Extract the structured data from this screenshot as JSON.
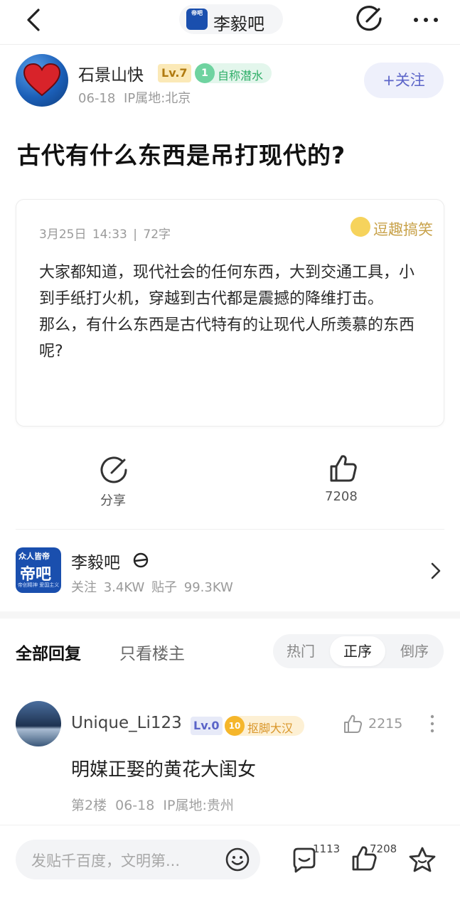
{
  "header": {
    "forum_name": "李毅吧",
    "forum_logo_text": "帝吧"
  },
  "author": {
    "name": "石景山快",
    "level": "Lv.7",
    "title_badge_num": "1",
    "title_badge": "自称潜水",
    "date": "06-18",
    "ip_location": "IP属地:北京",
    "follow_label": "+关注"
  },
  "post": {
    "title": "古代有什么东西是吊打现代的?",
    "card_meta": "3月25日 14:33 | 72字",
    "card_tag": "逗趣搞笑",
    "card_text": "大家都知道，现代社会的任何东西，大到交通工具，小到手纸打火机，穿越到古代都是震撼的降维打击。\n那么，有什么东西是古代特有的让现代人所羡慕的东西呢?"
  },
  "actions": {
    "share_label": "分享",
    "like_count": "7208"
  },
  "forum_info": {
    "logo_line1": "众人皆帝",
    "logo_line2": "帝吧",
    "logo_line3": "帝创精神 爱国主义",
    "name": "李毅吧",
    "stats": "关注 3.4KW  贴子 99.3KW"
  },
  "replies": {
    "tab_all": "全部回复",
    "tab_op_only": "只看楼主",
    "sort_options": [
      "热门",
      "正序",
      "倒序"
    ],
    "sort_selected": "正序"
  },
  "comment": {
    "username": "Unique_Li123",
    "level": "Lv.0",
    "badge_num": "10",
    "badge": "抠脚大汉",
    "like_count": "2215",
    "text": "明媒正娶的黄花大闺女",
    "meta": "第2楼  06-18  IP属地:贵州"
  },
  "bottom_bar": {
    "input_placeholder": "发贴千百度，文明第...",
    "comment_count": "1113",
    "like_count": "7208"
  },
  "colors": {
    "accent": "#5b64c8",
    "forum_blue": "#1a4fae",
    "level_gold": "#b07a10",
    "badge_green": "#2fae68"
  }
}
